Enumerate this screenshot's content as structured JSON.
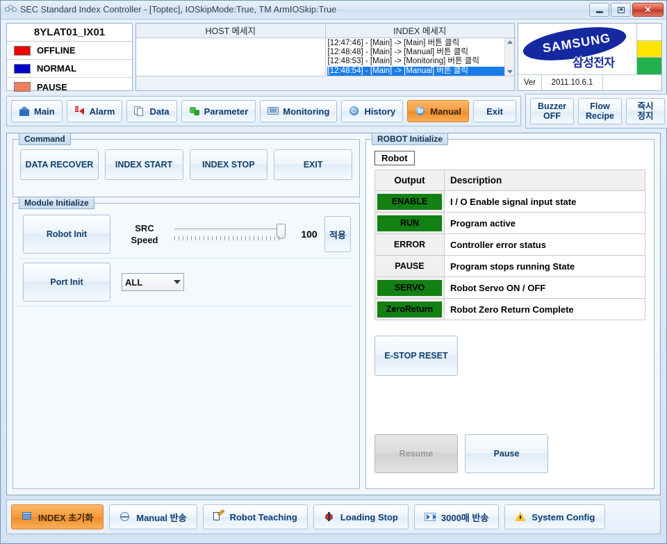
{
  "window": {
    "title": "SEC Standard Index Controller - [Toptec], IOSkipMode:True, TM ArmIOSkip:True",
    "icon": "app-rings-icon",
    "minimize": "minimize-icon",
    "maximize": "maximize-icon",
    "close": "close-icon"
  },
  "status_panel": {
    "equipment_id": "8YLAT01_IX01",
    "rows": [
      {
        "label": "OFFLINE",
        "color": "#ee0000"
      },
      {
        "label": "NORMAL",
        "color": "#0000cc"
      },
      {
        "label": "PAUSE",
        "color": "#f08060"
      }
    ]
  },
  "messages": {
    "host_header": "HOST 메세지",
    "index_header": "INDEX 메세지",
    "host_lines": [],
    "index_lines": [
      {
        "text": "[12:47:46] - [Main] -> [Main] 버튼 클릭",
        "selected": false
      },
      {
        "text": "[12:48:48] - [Main] -> [Manual] 버튼 클릭",
        "selected": false
      },
      {
        "text": "[12:48:53] - [Main] -> [Monitoring] 버튼 클릭",
        "selected": false
      },
      {
        "text": "[12:48:54] - [Main] -> [Manual] 버튼 클릭",
        "selected": true
      }
    ]
  },
  "brand": {
    "name": "SAMSUNG",
    "name_kr": "삼성전자",
    "version_label": "Ver",
    "version_value": "2011.10.6.1",
    "lamps": [
      "#ffffff",
      "#ffe400",
      "#22b14c"
    ]
  },
  "toolbar": {
    "left": [
      {
        "label": "Main",
        "icon": "home-icon",
        "accesskey": "M",
        "active": false
      },
      {
        "label": "Alarm",
        "icon": "alarm-icon",
        "accesskey": "A",
        "active": false
      },
      {
        "label": "Data",
        "icon": "data-icon",
        "accesskey": "D",
        "active": false
      },
      {
        "label": "Parameter",
        "icon": "parameter-icon",
        "accesskey": "P",
        "active": false
      },
      {
        "label": "Monitoring",
        "icon": "monitoring-icon",
        "accesskey": "o",
        "active": false
      },
      {
        "label": "History",
        "icon": "history-icon",
        "accesskey": "H",
        "active": false
      },
      {
        "label": "Manual",
        "icon": "manual-icon",
        "accesskey": "n",
        "active": true
      },
      {
        "label": "Exit",
        "icon": "none",
        "accesskey": "x",
        "active": false
      }
    ],
    "right": [
      {
        "line1": "Buzzer",
        "line2": "OFF"
      },
      {
        "line1": "Flow",
        "line2": "Recipe"
      },
      {
        "line1": "즉시",
        "line2": "정지"
      }
    ]
  },
  "command": {
    "title": "Command",
    "buttons": [
      "DATA RECOVER",
      "INDEX START",
      "INDEX STOP",
      "EXIT"
    ]
  },
  "module_initialize": {
    "title": "Module Initialize",
    "robot_init_label": "Robot Init",
    "port_init_label": "Port Init",
    "src_speed_line1": "SRC",
    "src_speed_line2": "Speed",
    "src_speed_value": "100",
    "apply_label": "적용",
    "port_select_value": "ALL"
  },
  "robot_initialize": {
    "title": "ROBOT Initialize",
    "tag": "Robot",
    "columns": [
      "Output",
      "Description"
    ],
    "rows": [
      {
        "output": "ENABLE",
        "description": "I / O Enable signal input state",
        "on": true
      },
      {
        "output": "RUN",
        "description": "Program active",
        "on": true
      },
      {
        "output": "ERROR",
        "description": "Controller error status",
        "on": false
      },
      {
        "output": "PAUSE",
        "description": "Program stops running State",
        "on": false
      },
      {
        "output": "SERVO",
        "description": "Robot Servo ON / OFF",
        "on": true
      },
      {
        "output": "ZeroReturn",
        "description": "Robot Zero Return Complete",
        "on": true
      }
    ],
    "estop_label": "E-STOP RESET",
    "resume_label": "Resume",
    "resume_disabled": true,
    "pause_label": "Pause",
    "on_color": "#128012"
  },
  "footer": {
    "buttons": [
      {
        "label": "INDEX 초기화",
        "icon": "cube-icon",
        "active": true
      },
      {
        "label": "Manual 반송",
        "icon": "globe-icon",
        "active": false
      },
      {
        "label": "Robot Teaching",
        "icon": "teaching-icon",
        "active": false
      },
      {
        "label": "Loading Stop",
        "icon": "bug-icon",
        "active": false
      },
      {
        "label": "3000매 반송",
        "icon": "fastforward-icon",
        "active": false
      },
      {
        "label": "System Config",
        "icon": "warning-icon",
        "active": false
      }
    ]
  },
  "accent": {
    "active_orange": "#f79a3c",
    "brand_blue": "#1428a0",
    "selection_blue": "#1a7ce8"
  }
}
